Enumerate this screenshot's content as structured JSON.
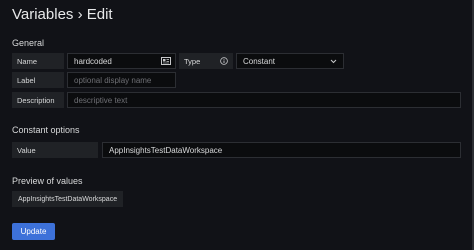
{
  "page": {
    "title": "Variables › Edit"
  },
  "general": {
    "heading": "General",
    "name": {
      "label": "Name",
      "value": "hardcoded"
    },
    "type": {
      "label": "Type",
      "selected": "Constant"
    },
    "label_field": {
      "label": "Label",
      "placeholder": "optional display name"
    },
    "description": {
      "label": "Description",
      "placeholder": "descriptive text"
    }
  },
  "constant_options": {
    "heading": "Constant options",
    "value": {
      "label": "Value",
      "value": "AppInsightsTestDataWorkspace"
    }
  },
  "preview": {
    "heading": "Preview of values",
    "values": [
      "AppInsightsTestDataWorkspace"
    ]
  },
  "actions": {
    "update_label": "Update"
  },
  "colors": {
    "accent": "#3d71d9",
    "background": "#111217"
  }
}
